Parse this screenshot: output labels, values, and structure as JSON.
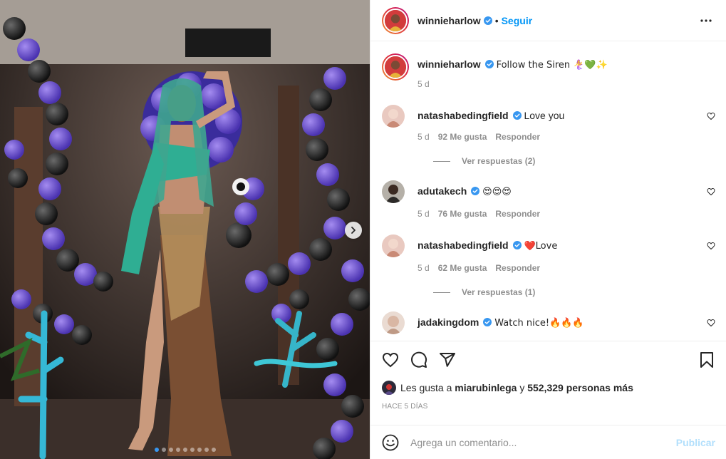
{
  "post": {
    "username": "winnieharlow",
    "follow_label": "Seguir",
    "separator": "•",
    "caption_text": "Follow the Siren 🧜‍♀️💚✨",
    "caption_age": "5 d"
  },
  "comments": [
    {
      "username": "natashabedingfield",
      "text": "Love you",
      "age": "5 d",
      "likes": "92 Me gusta",
      "reply": "Responder",
      "replies": "Ver respuestas (2)"
    },
    {
      "username": "adutakech",
      "text": "😍😍😍",
      "age": "5 d",
      "likes": "76 Me gusta",
      "reply": "Responder",
      "replies": ""
    },
    {
      "username": "natashabedingfield",
      "text": "❤️Love",
      "age": "5 d",
      "likes": "62 Me gusta",
      "reply": "Responder",
      "replies": "Ver respuestas (1)"
    },
    {
      "username": "jadakingdom",
      "text": "Watch nice!🔥🔥🔥",
      "age": "",
      "likes": "",
      "reply": "",
      "replies": ""
    }
  ],
  "likes": {
    "prefix": "Les gusta a",
    "user": "miarubinlega",
    "conjunction": "y",
    "others": "552,329 personas más"
  },
  "time_ago": "HACE 5 DÍAS",
  "add_comment": {
    "placeholder": "Agrega un comentario...",
    "publish_label": "Publicar"
  },
  "carousel": {
    "count": 9,
    "active_index": 0
  },
  "colors": {
    "accent": "#0095f6",
    "verified": "#3897f0",
    "publish_disabled": "#b2dffc",
    "muted": "#8e8e8e"
  },
  "icons": [
    "verified-icon",
    "more-options-icon",
    "heart-icon",
    "comment-icon",
    "share-icon",
    "save-icon",
    "emoji-icon",
    "chevron-right-icon"
  ]
}
